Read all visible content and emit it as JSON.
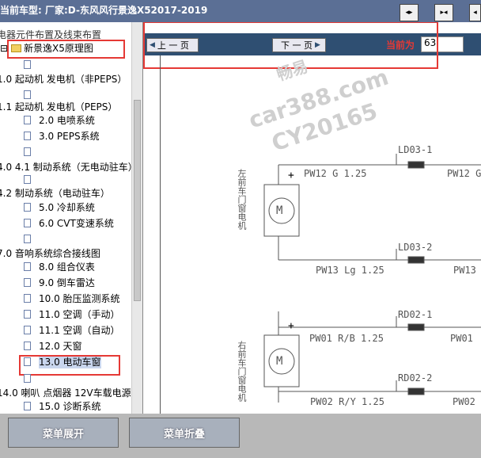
{
  "header": {
    "car_model": "当前车型: 厂家:D-东风风行景逸X52017-2019"
  },
  "tree": {
    "cut_top": "电器元件布置及线束布置",
    "root": "新景逸X5原理图",
    "items": [
      "1.0 起动机 发电机（非PEPS）",
      "1.1 起动机 发电机（PEPS）",
      "2.0 电喷系统",
      "3.0 PEPS系统",
      "4.0 4.1 制动系统（无电动驻车）",
      "4.2 制动系统（电动驻车）",
      "5.0 冷却系统",
      "6.0 CVT变速系统",
      "7.0 音响系统综合接线图",
      "8.0 组合仪表",
      "9.0 倒车雷达",
      "10.0 胎压监测系统",
      "11.0 空调（手动）",
      "11.1 空调（自动）",
      "12.0 天窗",
      "13.0 电动车窗",
      "14.0 喇叭 点烟器 12V车载电源",
      "15.0 诊断系统"
    ]
  },
  "nav": {
    "prev_label": "上 一 页",
    "next_label": "下 一 页",
    "current_label": "当前为",
    "current_page": "63"
  },
  "watermark": {
    "line1": "畅易",
    "line2": "car388.com",
    "line3": "CY20165"
  },
  "schematic": {
    "ld03_1": "LD03-1",
    "ld03_2": "LD03-2",
    "rd02_1": "RD02-1",
    "rd02_2": "RD02-2",
    "pw12": "PW12 G 1.25",
    "pw12_right": "PW12 G",
    "pw13": "PW13 Lg 1.25",
    "pw13_right": "PW13",
    "pw01": "PW01 R/B 1.25",
    "pw01_right": "PW01",
    "pw02": "PW02 R/Y 1.25",
    "pw02_right": "PW02",
    "motor1_label": "左前车门窗电机",
    "motor2_label": "右前车门窗电机",
    "motor_symbol": "M",
    "plus": "+"
  },
  "footer": {
    "expand_label": "菜单展开",
    "collapse_label": "菜单折叠"
  }
}
